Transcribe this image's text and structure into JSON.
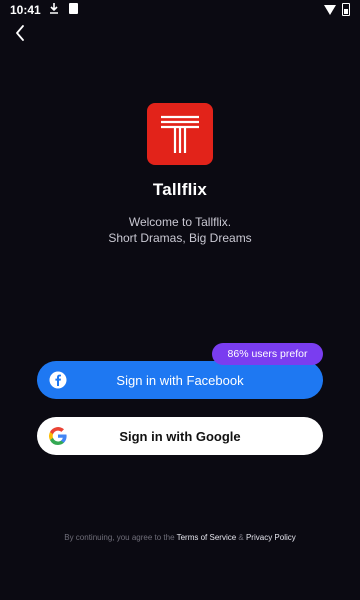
{
  "status_bar": {
    "time": "10:41"
  },
  "app": {
    "name": "Tallflix",
    "welcome": "Welcome to Tallflix.",
    "tagline": "Short Dramas, Big Dreams"
  },
  "badge": {
    "text": "86% users prefor"
  },
  "buttons": {
    "facebook": "Sign in with Facebook",
    "google": "Sign in with Google"
  },
  "legal": {
    "prefix": "By continuing, you agree to the ",
    "terms": "Terms of Service",
    "amp": " & ",
    "privacy": "Privacy Policy"
  },
  "colors": {
    "background": "#0b0a12",
    "brand_red": "#e2231a",
    "facebook_blue": "#1e78f2",
    "badge_purple": "#7a3df0"
  },
  "icons": [
    "back-arrow-icon",
    "facebook-icon",
    "google-icon",
    "download-icon",
    "wifi-icon",
    "battery-icon"
  ]
}
